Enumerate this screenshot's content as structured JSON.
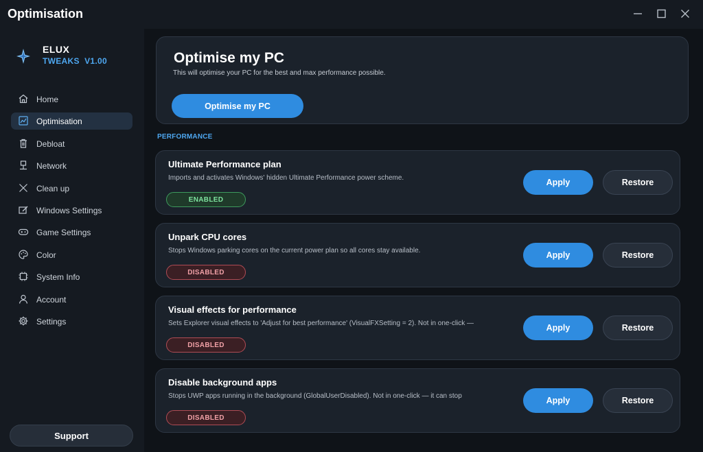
{
  "window": {
    "title": "Optimisation"
  },
  "brand": {
    "name": "ELUX",
    "subtitle": "TWEAKS  V1.00",
    "icon": "star-sparkle-icon"
  },
  "sidebar": {
    "items": [
      {
        "label": "Home",
        "icon": "home-icon"
      },
      {
        "label": "Optimisation",
        "icon": "chart-icon",
        "active": true
      },
      {
        "label": "Debloat",
        "icon": "trash-icon"
      },
      {
        "label": "Network",
        "icon": "network-icon"
      },
      {
        "label": "Clean up",
        "icon": "broom-icon"
      },
      {
        "label": "Windows Settings",
        "icon": "window-settings-icon"
      },
      {
        "label": "Game Settings",
        "icon": "gamepad-icon"
      },
      {
        "label": "Color",
        "icon": "palette-icon"
      },
      {
        "label": "System Info",
        "icon": "chip-icon"
      },
      {
        "label": "Account",
        "icon": "user-icon"
      },
      {
        "label": "Settings",
        "icon": "gear-icon"
      }
    ],
    "support_label": "Support"
  },
  "hero": {
    "title": "Optimise my PC",
    "description": "This will optimise your PC for the best and max performance possible.",
    "button_label": "Optimise my PC"
  },
  "section": {
    "label": "PERFORMANCE"
  },
  "tweaks": [
    {
      "title": "Ultimate Performance plan",
      "description": "Imports and activates Windows' hidden Ultimate Performance power scheme.",
      "status": "ENABLED",
      "apply_label": "Apply",
      "restore_label": "Restore"
    },
    {
      "title": "Unpark CPU cores",
      "description": "Stops Windows parking cores on the current power plan so all cores stay available.",
      "status": "DISABLED",
      "apply_label": "Apply",
      "restore_label": "Restore"
    },
    {
      "title": "Visual effects for performance",
      "description": "Sets Explorer visual effects to 'Adjust for best performance' (VisualFXSetting = 2). Not in one-click —",
      "status": "DISABLED",
      "apply_label": "Apply",
      "restore_label": "Restore"
    },
    {
      "title": "Disable background apps",
      "description": "Stops UWP apps running in the background (GlobalUserDisabled). Not in one-click — it can stop",
      "status": "DISABLED",
      "apply_label": "Apply",
      "restore_label": "Restore"
    }
  ],
  "colors": {
    "accent": "#2f8ce0",
    "accent_text": "#4ea7f0",
    "enabled": "#7ee29e",
    "disabled": "#f0a0a6",
    "background": "#0f1318",
    "card": "#1b222b"
  }
}
